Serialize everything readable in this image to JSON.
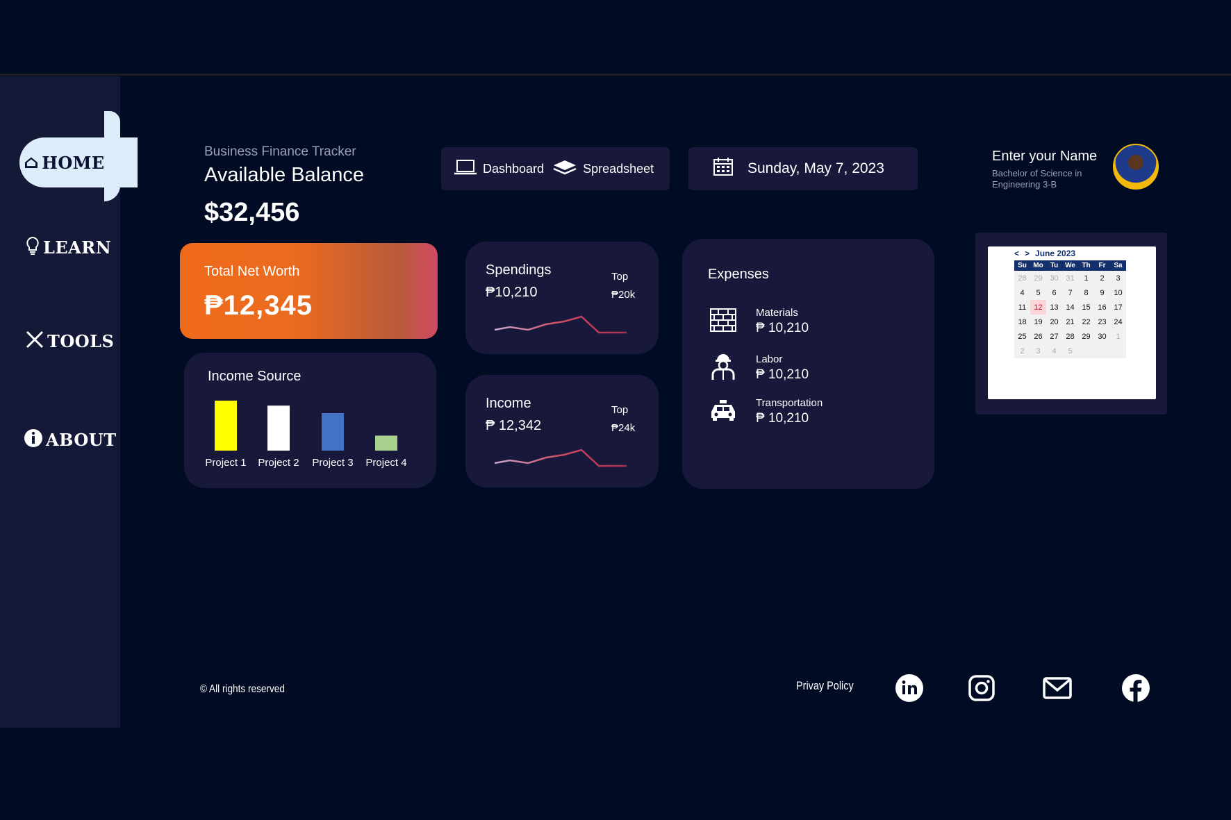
{
  "sidebar": {
    "items": [
      {
        "label": "HOME",
        "icon": "home-icon"
      },
      {
        "label": "LEARN",
        "icon": "lightbulb-icon"
      },
      {
        "label": "TOOLS",
        "icon": "tools-icon"
      },
      {
        "label": "ABOUT",
        "icon": "info-icon"
      }
    ]
  },
  "header": {
    "subtitle": "Business Finance Tracker",
    "title": "Available Balance",
    "balance": "$32,456"
  },
  "tabs": [
    {
      "label": "Dashboard",
      "icon": "laptop-icon"
    },
    {
      "label": "Spreadsheet",
      "icon": "layers-icon"
    }
  ],
  "date": {
    "label": "Sunday, May 7, 2023",
    "icon": "calendar-icon"
  },
  "profile": {
    "name": "Enter your Name",
    "degree": "Bachelor of Science in Engineering 3-B"
  },
  "net_worth": {
    "label": "Total Net Worth",
    "value": "₱12,345"
  },
  "income_source": {
    "title": "Income Source",
    "chart_data": {
      "type": "bar",
      "categories": [
        "Project 1",
        "Project 2",
        "Project 3",
        "Project 4"
      ],
      "values": [
        100,
        90,
        75,
        30
      ],
      "colors": [
        "#ffff00",
        "#ffffff",
        "#4472c4",
        "#a9d18e"
      ]
    }
  },
  "spendings": {
    "title": "Spendings",
    "value": "₱10,210",
    "top_label": "Top",
    "top_value": "₱20k"
  },
  "income": {
    "title": "Income",
    "value": "₱ 12,342",
    "top_label": "Top",
    "top_value": "₱24k"
  },
  "expenses": {
    "title": "Expenses",
    "items": [
      {
        "name": "Materials",
        "value": "₱ 10,210",
        "icon": "brick-wall-icon"
      },
      {
        "name": "Labor",
        "value": "₱ 10,210",
        "icon": "worker-icon"
      },
      {
        "name": "Transportation",
        "value": "₱ 10,210",
        "icon": "taxi-icon"
      }
    ]
  },
  "calendar": {
    "month": "June 2023",
    "prev": "<",
    "next": ">",
    "weekdays": [
      "Su",
      "Mo",
      "Tu",
      "We",
      "Th",
      "Fr",
      "Sa"
    ],
    "weeks": [
      [
        "28",
        "29",
        "30",
        "31",
        "1",
        "2",
        "3"
      ],
      [
        "4",
        "5",
        "6",
        "7",
        "8",
        "9",
        "10"
      ],
      [
        "11",
        "12",
        "13",
        "14",
        "15",
        "16",
        "17"
      ],
      [
        "18",
        "19",
        "20",
        "21",
        "22",
        "23",
        "24"
      ],
      [
        "25",
        "26",
        "27",
        "28",
        "29",
        "30",
        "1"
      ],
      [
        "2",
        "3",
        "4",
        "5",
        "",
        "",
        ""
      ]
    ],
    "today": "12"
  },
  "footer": {
    "copyright": "© All rights reserved",
    "privacy": "Privay Policy",
    "social": [
      "linkedin-icon",
      "instagram-icon",
      "mail-icon",
      "facebook-icon"
    ]
  },
  "colors": {
    "background": "#020b24",
    "card": "#17183a",
    "sidebar": "#151938",
    "accent_orange": "#f06a1b",
    "spark_line": "#d04a63"
  }
}
